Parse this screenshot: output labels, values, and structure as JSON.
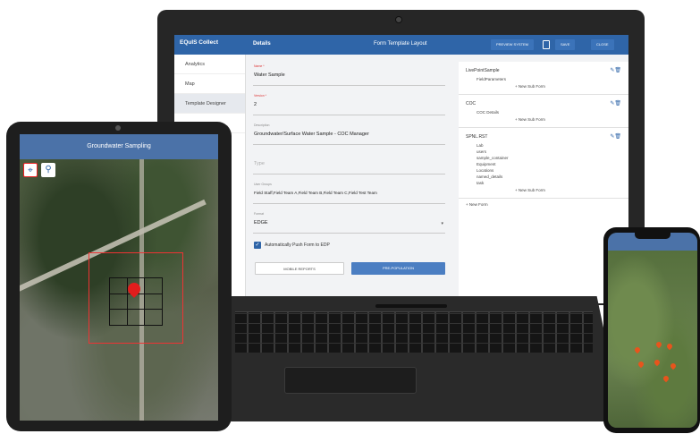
{
  "laptop": {
    "app": {
      "logo": "EQuIS Collect",
      "logo_sub": "",
      "header_title": "Details",
      "form_title": "Form Template Layout",
      "preview_button": "PREVIEW SYSTEM",
      "save_button": "SAVE",
      "close_button": "CLOSE"
    },
    "sidebar": {
      "items": [
        {
          "label": "Analytics"
        },
        {
          "label": "Map"
        },
        {
          "label": "Template Designer"
        },
        {
          "label": ""
        }
      ]
    },
    "form": {
      "fields": [
        {
          "label": "Name *",
          "value": "Water Sample",
          "required": true
        },
        {
          "label": "Version *",
          "value": "2",
          "required": true
        },
        {
          "label": "Description",
          "value": "Groundwater/Surface Water Sample - COC Manager",
          "required": false
        },
        {
          "label": "",
          "value": "Type",
          "required": false
        },
        {
          "label": "User Groups",
          "value": "Field Staff,Field Team A,Field Team B,Field Team C,Field Test Team",
          "required": false
        },
        {
          "label": "Format",
          "value": "EDGE",
          "required": false,
          "dropdown": true
        }
      ],
      "auto_push_label": "Automatically Push Form to EDP",
      "auto_push_checked": true,
      "mobile_reports_button": "MOBILE REPORTS",
      "prepopulation_button": "PRE-POPULATION"
    },
    "tree": {
      "groups": [
        {
          "name": "LivePointSample",
          "subs": [
            "FieldParameters"
          ],
          "new_label": "+ New Sub Form"
        },
        {
          "name": "COC",
          "subs": [
            "COC Details"
          ],
          "new_label": "+ New Sub Form"
        },
        {
          "name": "SPNL.RST",
          "subs": [
            "Lab",
            "users",
            "sample_container",
            "Equipment",
            "Locations",
            "named_details",
            "task"
          ],
          "new_label": "+ New Sub Form"
        }
      ],
      "new_form_label": "+ New Form"
    }
  },
  "tablet": {
    "title": "Groundwater Sampling",
    "pin_label": "",
    "tools": [
      "crosshair-icon",
      "map-pin-icon"
    ]
  },
  "phone": {
    "title": ""
  },
  "colors": {
    "brand_blue": "#2f65a8",
    "pin_red": "#e21d1d"
  }
}
